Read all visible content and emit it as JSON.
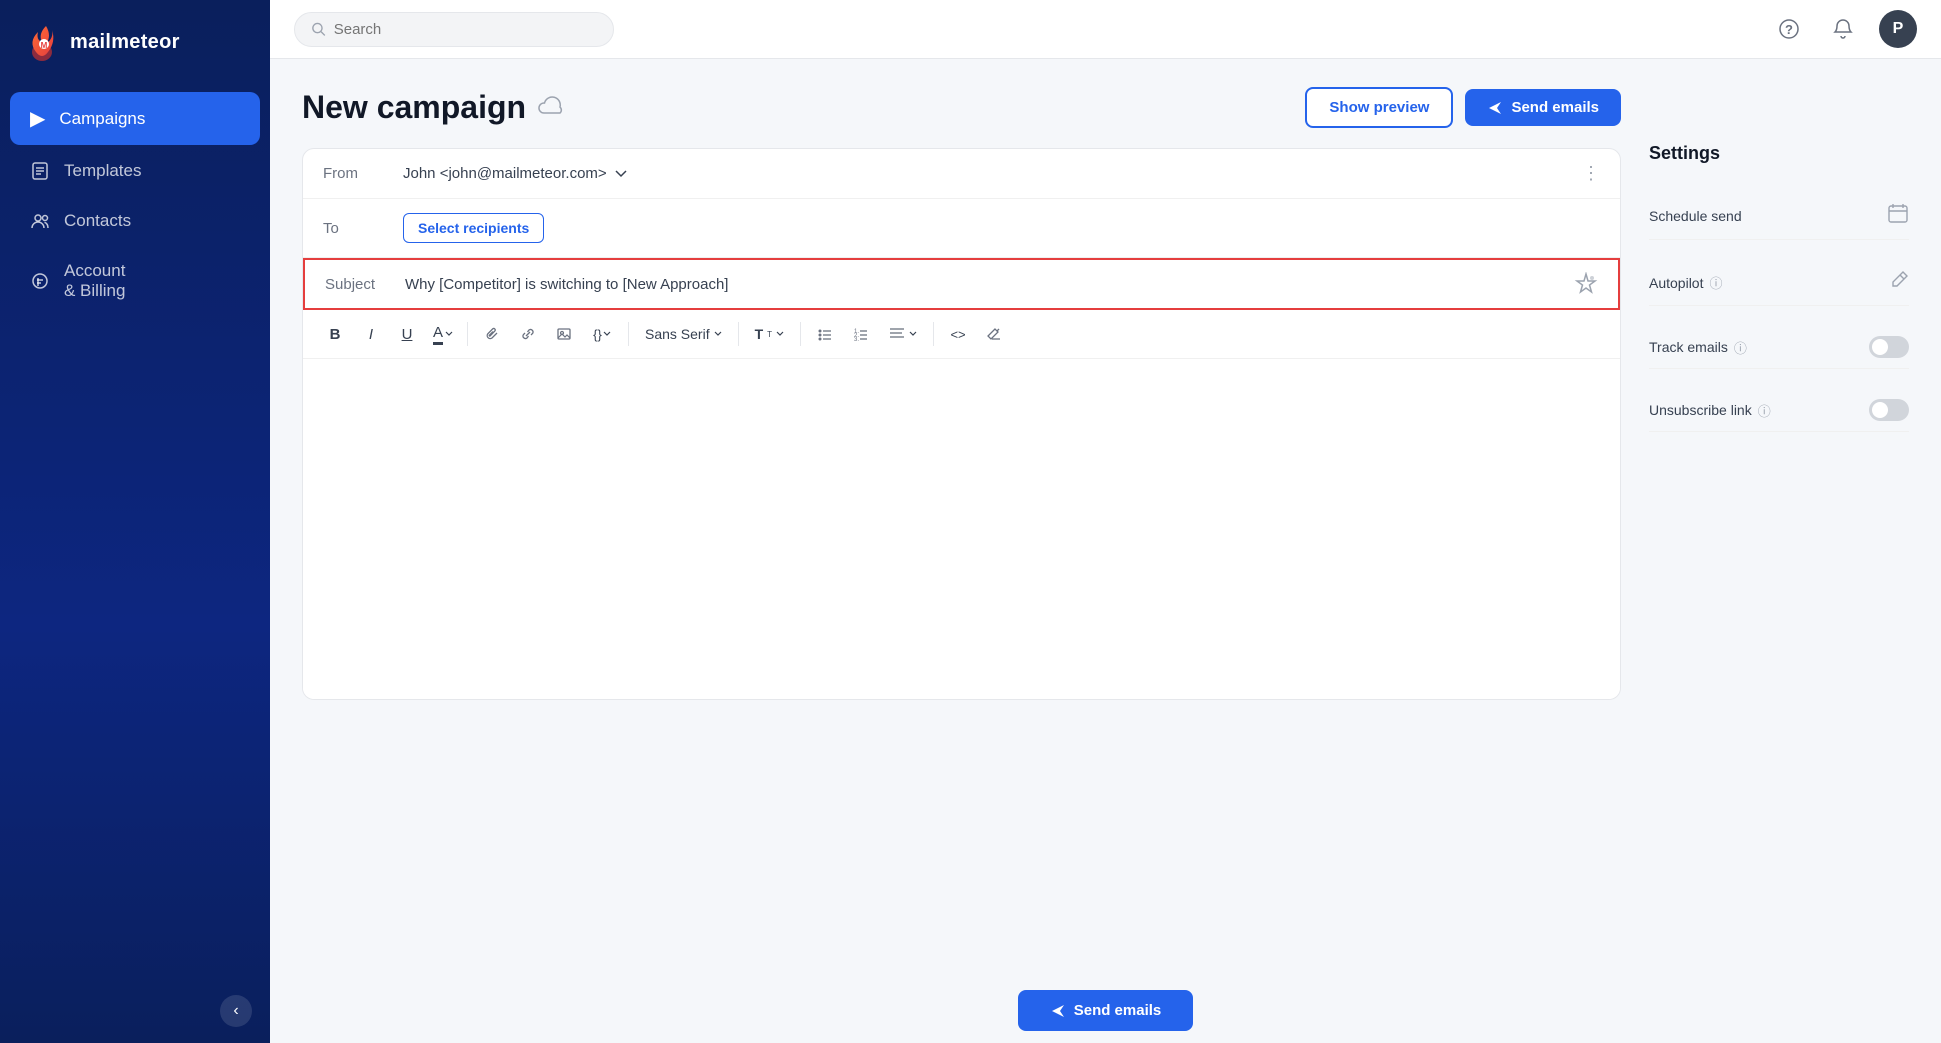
{
  "app": {
    "name": "mailmeteor"
  },
  "sidebar": {
    "nav_items": [
      {
        "id": "campaigns",
        "label": "Campaigns",
        "icon": "▶",
        "active": true
      },
      {
        "id": "templates",
        "label": "Templates",
        "icon": "📄",
        "active": false
      },
      {
        "id": "contacts",
        "label": "Contacts",
        "icon": "👥",
        "active": false
      },
      {
        "id": "billing",
        "label": "Account & Billing",
        "icon": "⚙",
        "active": false
      }
    ],
    "collapse_icon": "‹"
  },
  "topbar": {
    "search_placeholder": "Search",
    "help_icon": "?",
    "bell_icon": "🔔",
    "avatar_label": "P"
  },
  "page": {
    "title": "New campaign",
    "cloud_icon": "☁"
  },
  "header_buttons": {
    "show_preview": "Show preview",
    "send_emails": "Send emails"
  },
  "composer": {
    "from_label": "From",
    "from_value": "John <john@mailmeteor.com>",
    "to_label": "To",
    "select_recipients_label": "Select recipients",
    "subject_label": "Subject",
    "subject_value": "Why [Competitor] is switching to [New Approach]"
  },
  "toolbar": {
    "bold": "B",
    "italic": "I",
    "underline": "U",
    "text_color": "A",
    "attach": "📎",
    "link": "🔗",
    "image": "🖼",
    "variable": "{}",
    "font": "Sans Serif",
    "font_size": "T",
    "bullet_list": "≡",
    "number_list": "≡",
    "align": "≡",
    "code": "<>",
    "clear": "✕"
  },
  "settings": {
    "title": "Settings",
    "items": [
      {
        "id": "schedule",
        "label": "Schedule send",
        "has_toggle": false,
        "has_icon": true,
        "icon": "📅"
      },
      {
        "id": "autopilot",
        "label": "Autopilot",
        "has_info": true,
        "has_toggle": false,
        "has_icon": true,
        "icon": "✏"
      },
      {
        "id": "track",
        "label": "Track emails",
        "has_info": true,
        "has_toggle": true,
        "toggle_on": false
      },
      {
        "id": "unsubscribe",
        "label": "Unsubscribe link",
        "has_info": true,
        "has_toggle": true,
        "toggle_on": false
      }
    ]
  },
  "bottom": {
    "send_label": "Send emails"
  }
}
